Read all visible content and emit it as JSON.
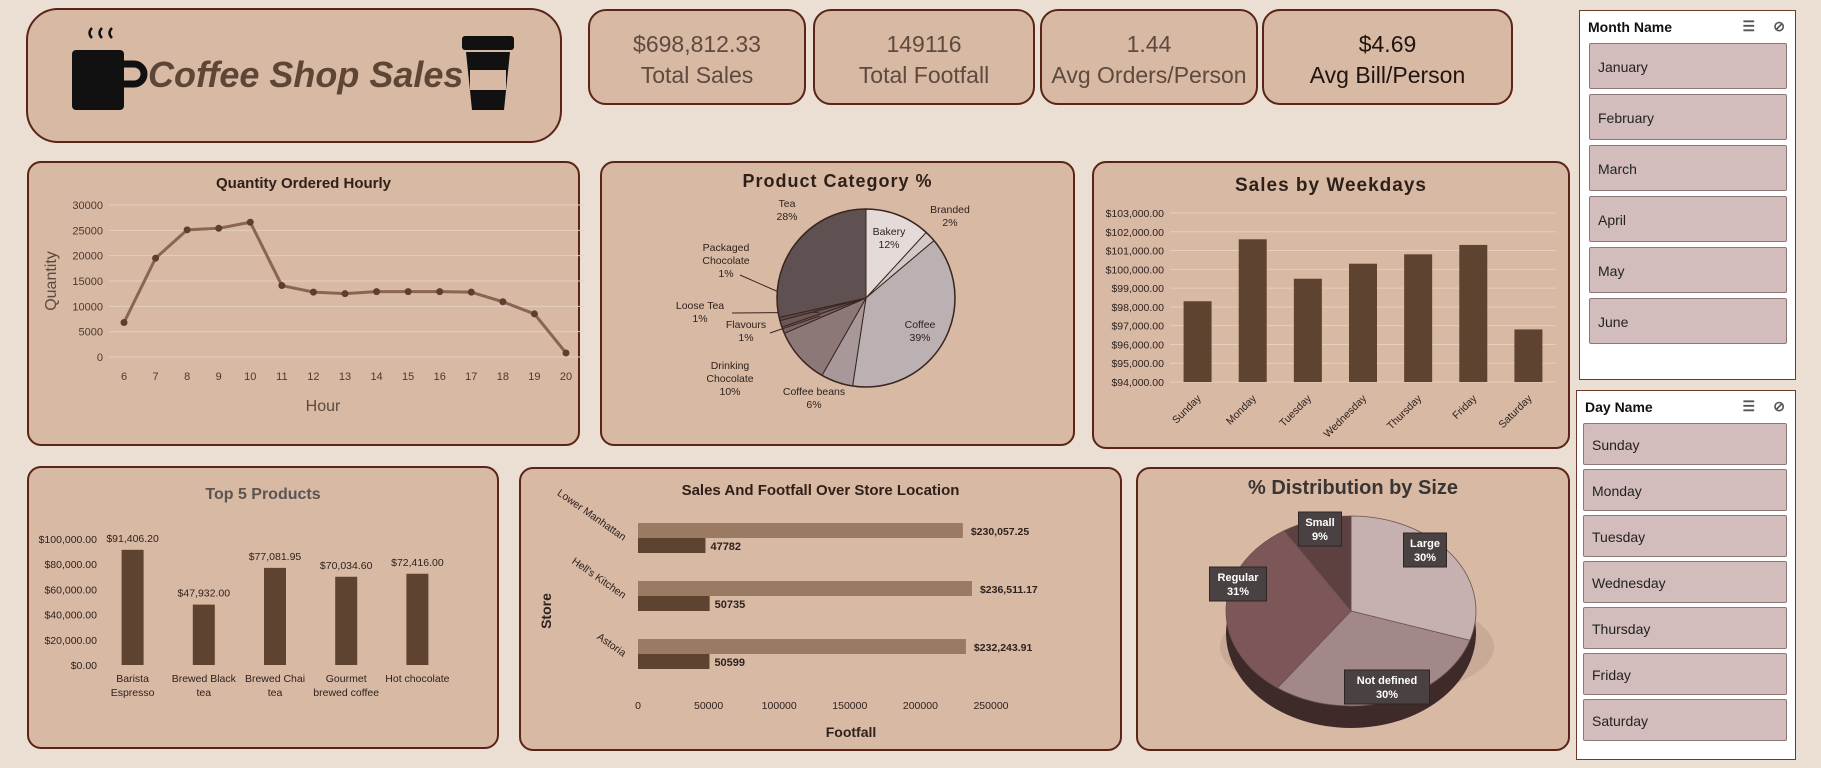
{
  "header": {
    "title": "Coffee Shop Sales"
  },
  "kpis": [
    {
      "value": "$698,812.33",
      "label": "Total Sales"
    },
    {
      "value": "149116",
      "label": "Total Footfall"
    },
    {
      "value": "1.44",
      "label": "Avg Orders/Person"
    },
    {
      "value": "$4.69",
      "label": "Avg Bill/Person"
    }
  ],
  "slicers": {
    "month": {
      "title": "Month Name",
      "items": [
        "January",
        "February",
        "March",
        "April",
        "May",
        "June"
      ]
    },
    "day": {
      "title": "Day Name",
      "items": [
        "Sunday",
        "Monday",
        "Tuesday",
        "Wednesday",
        "Thursday",
        "Friday",
        "Saturday"
      ]
    }
  },
  "colors": {
    "background": "#eadfd2",
    "card": "#d8b9a3",
    "border": "#5a2418",
    "bar": "#5e4331",
    "bar_light": "#9b7a63",
    "line": "#8a6652"
  },
  "chart_data": [
    {
      "id": "hourly",
      "type": "line",
      "title": "Quantity Ordered Hourly",
      "xlabel": "Hour",
      "ylabel": "Quantity",
      "x": [
        "6",
        "7",
        "8",
        "9",
        "10",
        "11",
        "12",
        "13",
        "14",
        "15",
        "16",
        "17",
        "18",
        "19",
        "20"
      ],
      "values": [
        6800,
        19500,
        25100,
        25400,
        26600,
        14100,
        12800,
        12500,
        12900,
        12900,
        12900,
        12800,
        10900,
        8500,
        800
      ],
      "yticks": [
        "0",
        "5000",
        "10000",
        "15000",
        "20000",
        "25000",
        "30000"
      ],
      "ylim": [
        0,
        30000
      ],
      "grid": true
    },
    {
      "id": "category",
      "type": "pie",
      "title": "Product Category %",
      "slices": [
        {
          "name": "Bakery",
          "pct": "12%",
          "value": 11.82,
          "color": "#e4dbd8"
        },
        {
          "name": "Branded",
          "pct": "2%",
          "value": 2.02,
          "color": "#d3c9c8"
        },
        {
          "name": "Coffee",
          "pct": "39%",
          "value": 38.56,
          "color": "#bbb0b2"
        },
        {
          "name": "Coffee beans",
          "pct": "6%",
          "value": 5.83,
          "color": "#a89899"
        },
        {
          "name": "Drinking Chocolate",
          "pct": "10%",
          "value": 10.27,
          "color": "#8d7878"
        },
        {
          "name": "Flavours",
          "pct": "1%",
          "value": 1.2,
          "color": "#7a6566"
        },
        {
          "name": "Loose Tea",
          "pct": "1%",
          "value": 1.2,
          "color": "#6d5656"
        },
        {
          "name": "Packaged Chocolate",
          "pct": "1%",
          "value": 0.6,
          "color": "#5e4949"
        },
        {
          "name": "Tea",
          "pct": "28%",
          "value": 28.5,
          "color": "#5f5052"
        }
      ]
    },
    {
      "id": "weekday",
      "type": "bar",
      "title": "Sales by Weekdays",
      "categories": [
        "Sunday",
        "Monday",
        "Tuesday",
        "Wednesday",
        "Thursday",
        "Friday",
        "Saturday"
      ],
      "values": [
        98300,
        101600,
        99500,
        100300,
        100800,
        101300,
        96800
      ],
      "yticks": [
        "$94,000.00",
        "$95,000.00",
        "$96,000.00",
        "$97,000.00",
        "$98,000.00",
        "$99,000.00",
        "$100,000.00",
        "$101,000.00",
        "$102,000.00",
        "$103,000.00"
      ],
      "ylim": [
        94000,
        103000
      ],
      "grid": true
    },
    {
      "id": "top5",
      "type": "bar",
      "title": "Top 5 Products",
      "categories": [
        [
          "Barista",
          "Espresso"
        ],
        [
          "Brewed Black",
          "tea"
        ],
        [
          "Brewed Chai",
          "tea"
        ],
        [
          "Gourmet",
          "brewed coffee"
        ],
        [
          "Hot chocolate"
        ]
      ],
      "values": [
        91406.2,
        47932.0,
        77081.95,
        70034.6,
        72416.0
      ],
      "labels": [
        "$91,406.20",
        "$47,932.00",
        "$77,081.95",
        "$70,034.60",
        "$72,416.00"
      ],
      "yticks": [
        "$0.00",
        "$20,000.00",
        "$40,000.00",
        "$60,000.00",
        "$80,000.00",
        "$100,000.00"
      ],
      "ylim": [
        0,
        100000
      ]
    },
    {
      "id": "store",
      "type": "bar",
      "orientation": "horizontal",
      "title": "Sales And Footfall Over Store Location",
      "xlabel": "Footfall",
      "ylabel": "Store",
      "categories": [
        "Lower Manhattan",
        "Hell's Kitchen",
        "Astoria"
      ],
      "series": [
        {
          "values": [
            230057.25,
            236511.17,
            232243.91
          ],
          "labels": [
            "$230,057.25",
            "$236,511.17",
            "$232,243.91"
          ],
          "color": "#9b7a63"
        },
        {
          "values": [
            47782,
            50735,
            50599
          ],
          "labels": [
            "47782",
            "50735",
            "50599"
          ],
          "color": "#5e4331"
        }
      ],
      "xticks": [
        "0",
        "50000",
        "100000",
        "150000",
        "200000",
        "250000"
      ],
      "xlim": [
        0,
        250000
      ]
    },
    {
      "id": "size",
      "type": "pie",
      "title": "% Distribution by Size",
      "slices": [
        {
          "name": "Large",
          "pct": "30%",
          "value": 30,
          "color": "#c7b1b0"
        },
        {
          "name": "Not defined",
          "pct": "30%",
          "value": 30,
          "color": "#a28888"
        },
        {
          "name": "Regular",
          "pct": "31%",
          "value": 31,
          "color": "#7d5757"
        },
        {
          "name": "Small",
          "pct": "9%",
          "value": 9,
          "color": "#5d4040"
        }
      ]
    }
  ]
}
